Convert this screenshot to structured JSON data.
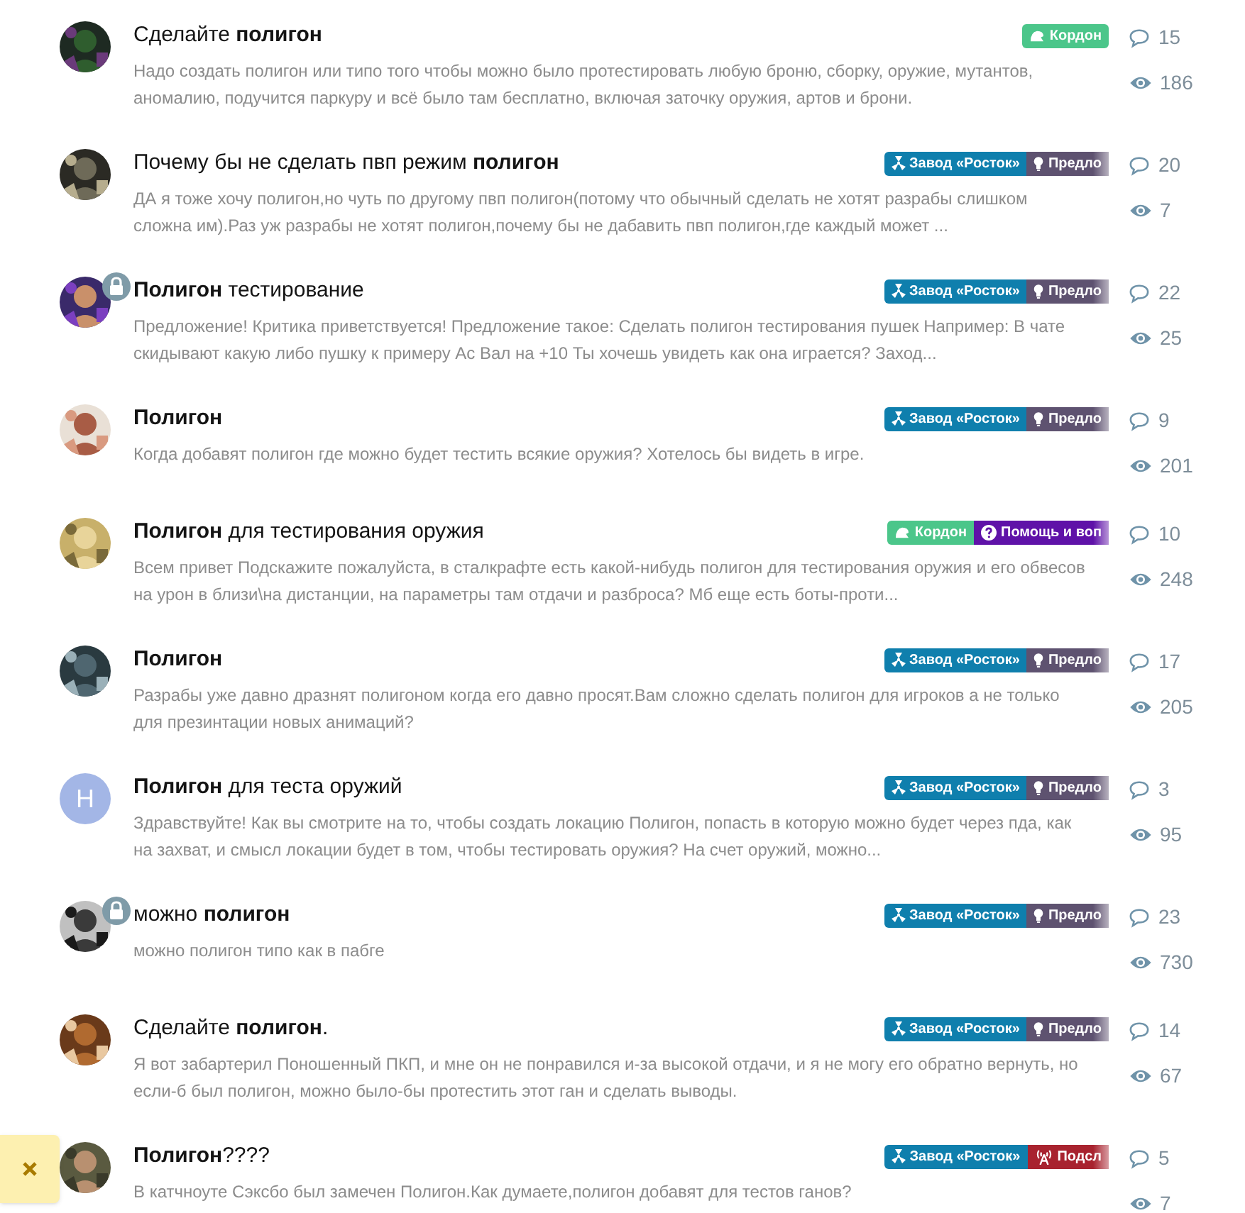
{
  "threads": [
    {
      "avatar": {
        "kind": "picture"
      },
      "locked": false,
      "title": "Сделайте **полигон**",
      "tags_faded": false,
      "tags": [
        {
          "kind": "kordon",
          "label": "Кордон",
          "color": "#4bc68a"
        }
      ],
      "snippet": "Надо создать полигон или типо того чтобы можно было протестировать любую броню, сборку, оружие, мутантов, аномалию, подучится паркуру и всё было там бесплатно, включая заточку оружия, артов и брони.",
      "replies": "15",
      "views": "186"
    },
    {
      "avatar": {
        "kind": "picture"
      },
      "locked": false,
      "title": "Почему бы не сделать пвп режим **полигон**",
      "tags_faded": true,
      "tags": [
        {
          "kind": "rostok",
          "label": "Завод «Росток»",
          "color": "#0f7fad"
        },
        {
          "kind": "idea",
          "label": "Предло",
          "color": "#5e5270"
        }
      ],
      "snippet": "ДА я тоже хочу полигон,но чуть по другому пвп полигон(потому что обычный сделать не хотят разрабы слишком сложна им).Раз уж разрабы не хотят полигон,почему бы не дабавить пвп полигон,где каждый может ...",
      "replies": "20",
      "views": "7"
    },
    {
      "avatar": {
        "kind": "picture"
      },
      "locked": true,
      "title": "**Полигон** тестирование",
      "tags_faded": true,
      "tags": [
        {
          "kind": "rostok",
          "label": "Завод «Росток»",
          "color": "#0f7fad"
        },
        {
          "kind": "idea",
          "label": "Предло",
          "color": "#5e5270"
        }
      ],
      "snippet": "Предложение! Критика приветствуется! Предложение такое: Сделать полигон тестирования пушек Например: В чате скидывают какую либо пушку к примеру Ас Вал на +10 Ты хочешь увидеть как она играется? Заход...",
      "replies": "22",
      "views": "25"
    },
    {
      "avatar": {
        "kind": "picture"
      },
      "locked": false,
      "title": "**Полигон**",
      "tags_faded": true,
      "tags": [
        {
          "kind": "rostok",
          "label": "Завод «Росток»",
          "color": "#0f7fad"
        },
        {
          "kind": "idea",
          "label": "Предло",
          "color": "#5e5270"
        }
      ],
      "snippet": "Когда добавят полигон где можно будет тестить всякие оружия? Хотелось бы видеть в игре.",
      "replies": "9",
      "views": "201"
    },
    {
      "avatar": {
        "kind": "picture"
      },
      "locked": false,
      "title": "**Полигон** для тестирования оружия",
      "tags_faded": true,
      "tags": [
        {
          "kind": "kordon",
          "label": "Кордон",
          "color": "#4bc68a"
        },
        {
          "kind": "help",
          "label": "Помощь и воп",
          "color": "#5f12a8"
        }
      ],
      "snippet": "Всем привет Подскажите пожалуйста, в сталкрафте есть какой-нибудь полигон для тестирования оружия и его обвесов на урон в близи\\на дистанции, на параметры там отдачи и разброса? Мб еще есть боты-проти...",
      "replies": "10",
      "views": "248"
    },
    {
      "avatar": {
        "kind": "picture"
      },
      "locked": false,
      "title": "**Полигон**",
      "tags_faded": true,
      "tags": [
        {
          "kind": "rostok",
          "label": "Завод «Росток»",
          "color": "#0f7fad"
        },
        {
          "kind": "idea",
          "label": "Предло",
          "color": "#5e5270"
        }
      ],
      "snippet": "Разрабы уже давно дразнят полигоном когда его давно просят.Вам сложно сделать полигон для игроков а не только для презинтации новых анимаций?",
      "replies": "17",
      "views": "205"
    },
    {
      "avatar": {
        "kind": "letter",
        "letter": "H"
      },
      "locked": false,
      "title": "**Полигон** для теста оружий",
      "tags_faded": true,
      "tags": [
        {
          "kind": "rostok",
          "label": "Завод «Росток»",
          "color": "#0f7fad"
        },
        {
          "kind": "idea",
          "label": "Предло",
          "color": "#5e5270"
        }
      ],
      "snippet": "Здравствуйте! Как вы смотрите на то, чтобы создать локацию Полигон, попасть в которую можно будет через пда, как на захват, и смысл локации будет в том, чтобы тестировать оружия? На счет оружий, можно...",
      "replies": "3",
      "views": "95"
    },
    {
      "avatar": {
        "kind": "picture"
      },
      "locked": true,
      "title": "можно **полигон**",
      "tags_faded": true,
      "tags": [
        {
          "kind": "rostok",
          "label": "Завод «Росток»",
          "color": "#0f7fad"
        },
        {
          "kind": "idea",
          "label": "Предло",
          "color": "#5e5270"
        }
      ],
      "snippet": "можно полигон типо как в пабге",
      "replies": "23",
      "views": "730"
    },
    {
      "avatar": {
        "kind": "picture"
      },
      "locked": false,
      "title": "Сделайте **полигон**.",
      "tags_faded": true,
      "tags": [
        {
          "kind": "rostok",
          "label": "Завод «Росток»",
          "color": "#0f7fad"
        },
        {
          "kind": "idea",
          "label": "Предло",
          "color": "#5e5270"
        }
      ],
      "snippet": "Я вот забартерил Поношенный ПКП, и мне он не понравился и-за высокой отдачи, и я не могу его обратно вернуть, но если-б был полигон, можно было-бы протестить этот ган и сделать выводы.",
      "replies": "14",
      "views": "67"
    },
    {
      "avatar": {
        "kind": "picture"
      },
      "locked": false,
      "title": "**Полигон**????",
      "tags_faded": true,
      "tags": [
        {
          "kind": "rostok",
          "label": "Завод «Росток»",
          "color": "#0f7fad"
        },
        {
          "kind": "radio",
          "label": "Подсл",
          "color": "#a8232f"
        }
      ],
      "snippet": "В катчноуте Сэксбо был замечен Полигон.Как думаете,полигон добавят для тестов ганов?",
      "replies": "5",
      "views": "7"
    }
  ],
  "notice": {
    "closable": true
  }
}
